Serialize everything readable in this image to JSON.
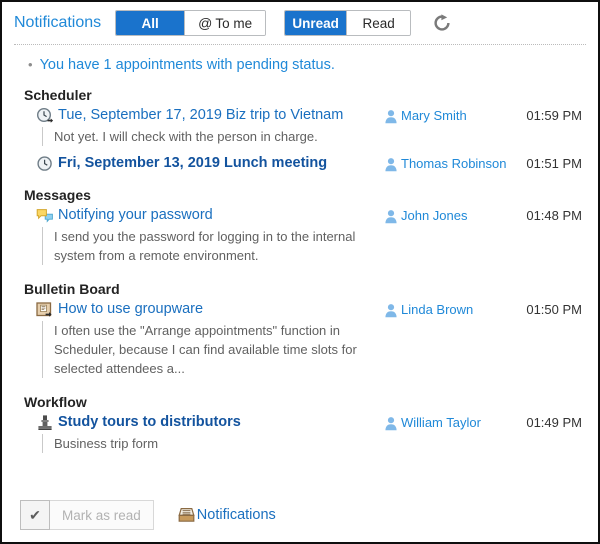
{
  "window": {
    "title": "Notifications",
    "border_color": "#0f0f0f"
  },
  "theme": {
    "accent_blue": "#1a73cc",
    "link_blue": "#2089d8",
    "title_link_blue": "#1a6fbf",
    "unread_blue": "#13539e",
    "body_gray": "#616161",
    "heading_black": "#232323"
  },
  "header": {
    "title": "Notifications",
    "filter_tabs": [
      {
        "label": "All",
        "icon": "",
        "active": true
      },
      {
        "label": "To me",
        "icon": "@",
        "active": false
      }
    ],
    "status_tabs": [
      {
        "label": "Unread",
        "active": true
      },
      {
        "label": "Read",
        "active": false
      }
    ],
    "refresh_icon": "refresh-icon"
  },
  "summary": {
    "bullet": "•",
    "text": "You have 1 appointments with pending status."
  },
  "sections": [
    {
      "title": "Scheduler",
      "items": [
        {
          "icon": "clock-arrow-icon",
          "title": "Tue, September 17, 2019 Biz trip to Vietnam",
          "unread": false,
          "body": "Not yet. I will check with the person in charge.",
          "user": "Mary Smith",
          "time": "01:59 PM"
        },
        {
          "icon": "clock-icon",
          "title": "Fri, September 13, 2019 Lunch meeting",
          "unread": true,
          "body": "",
          "user": "Thomas Robinson",
          "time": "01:51 PM"
        }
      ]
    },
    {
      "title": "Messages",
      "items": [
        {
          "icon": "speech-bubbles-icon",
          "title": "Notifying your password",
          "unread": false,
          "body": "I send you the password for logging in to the internal system from a remote environment.",
          "user": "John Jones",
          "time": "01:48 PM"
        }
      ]
    },
    {
      "title": "Bulletin Board",
      "items": [
        {
          "icon": "bulletin-board-icon",
          "title": "How to use groupware",
          "unread": false,
          "body": "I often use the \"Arrange appointments\" function in Scheduler, because I can find available time slots for selected attendees a...",
          "user": "Linda Brown",
          "time": "01:50 PM"
        }
      ]
    },
    {
      "title": "Workflow",
      "items": [
        {
          "icon": "stamp-icon",
          "title": "Study tours to distributors",
          "unread": true,
          "body": "Business trip form",
          "user": "William Taylor",
          "time": "01:49 PM"
        }
      ]
    }
  ],
  "footer": {
    "check_label": "✔",
    "mark_as_read_label": "Mark as read",
    "notifications_link": "Notifications",
    "notifications_icon": "inbox-tray-icon"
  }
}
